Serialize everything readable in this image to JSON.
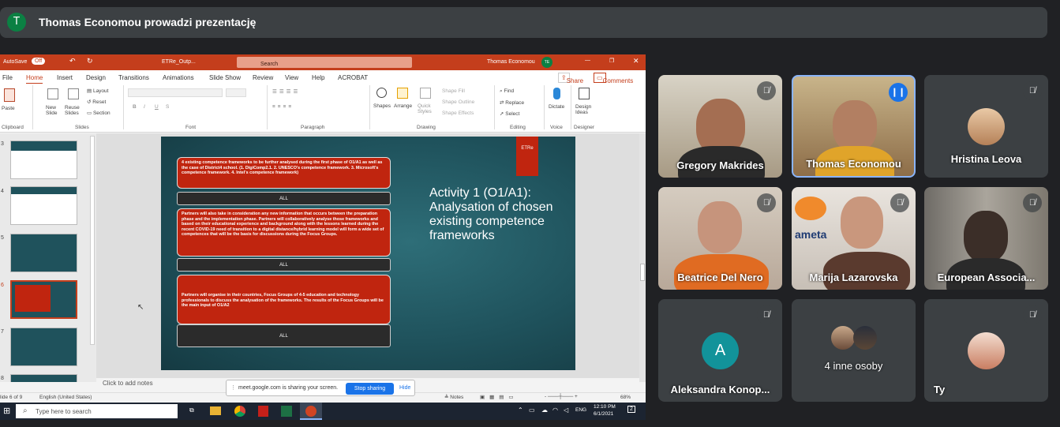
{
  "meet": {
    "presenter_initial": "T",
    "presenting_text": "Thomas Economou prowadzi prezentację",
    "others_label": "4 inne osoby",
    "self_label": "Ty",
    "participants": [
      {
        "name": "Gregory Makrides"
      },
      {
        "name": "Thomas Economou"
      },
      {
        "name": "Hristina Leova"
      },
      {
        "name": "Beatrice Del Nero"
      },
      {
        "name": "Marija Lazarovska"
      },
      {
        "name": "European Associa..."
      },
      {
        "name": "Aleksandra Konop...",
        "initial": "A"
      }
    ]
  },
  "ppt": {
    "autosave": "AutoSave",
    "toggle": "Off",
    "file_name": "ETRe_Outp...",
    "search": "Search",
    "user": "Thomas Economou",
    "user_initials": "TE",
    "tabs": [
      "File",
      "Home",
      "Insert",
      "Design",
      "Transitions",
      "Animations",
      "Slide Show",
      "Review",
      "View",
      "Help",
      "ACROBAT"
    ],
    "share": "Share",
    "comments": "Comments",
    "ribbon": {
      "paste": "Paste",
      "clipboard": "Clipboard",
      "new_slide": "New Slide",
      "reuse": "Reuse Slides",
      "layout": "Layout",
      "reset": "Reset",
      "section": "Section",
      "slides": "Slides",
      "font": "Font",
      "paragraph": "Paragraph",
      "shapes": "Shapes",
      "arrange": "Arrange",
      "quick_styles": "Quick Styles",
      "shape_fill": "Shape Fill",
      "shape_outline": "Shape Outline",
      "shape_effects": "Shape Effects",
      "drawing": "Drawing",
      "find": "Find",
      "replace": "Replace",
      "select": "Select",
      "editing": "Editing",
      "dictate": "Dictate",
      "voice": "Voice",
      "design_ideas": "Design Ideas",
      "designer": "Designer"
    },
    "thumb_numbers": [
      "3",
      "4",
      "5",
      "6",
      "7",
      "8"
    ],
    "slide": {
      "box1": "4 existing competence frameworks to be further analysed during the first phase of O1/A1 as well as the case of District4 school. (1. DigiComp2.1. 2. UNESCO's competence framework. 3. Microsoft's competence framework. 4. Intel's competence framework)",
      "box2": "Partners will also take in consideration any new information that occurs between the preparation phase and the implementation phase. Partners will collaboratively analyse those frameworks and based on their educational experience and background along with the lessons learned during the recent COVID-19 need of transition to a digital distance/hybrid learning model will form a wide set of competences that will be the basis for discussions during the Focus Groups.",
      "box3": "Partners will organise in their countries, Focus Groups of 4-5 education and technology professionals to discuss the analysation of the frameworks. The results of the Focus Groups will be the main input of O1/A2",
      "all": "ALL",
      "title": "Activity 1 (O1/A1): Analysation of chosen existing competence frameworks",
      "logo": "ETRe"
    },
    "notes": "Click to add notes",
    "status_slide": "lide 6 of 9",
    "status_lang": "English (United States)",
    "notes_btn": "Notes",
    "zoom": "68%"
  },
  "share_popup": {
    "text": "meet.google.com is sharing your screen.",
    "stop": "Stop sharing",
    "hide": "Hide"
  },
  "taskbar": {
    "search": "Type here to search",
    "time": "12:10 PM",
    "date": "6/1/2021",
    "lang": "ENG",
    "notif": "2"
  }
}
